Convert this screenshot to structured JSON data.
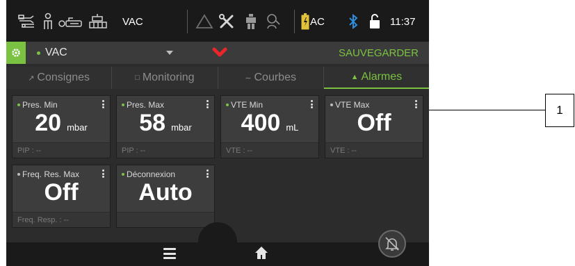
{
  "status_bar": {
    "mode_label": "VAC",
    "power_label": "AC",
    "time": "11:37",
    "icons": [
      "ventilation-circuit-icon",
      "patient-icon",
      "mask-icon",
      "hme-icon",
      "alarm-triangle-icon",
      "tools-icon",
      "pressure-source-icon",
      "profile-icon",
      "battery-icon",
      "bluetooth-icon",
      "lock-icon"
    ]
  },
  "header": {
    "mode_value": "VAC",
    "save_label": "SAUVEGARDER"
  },
  "tabs": [
    {
      "label": "Consignes",
      "icon": "wrench-icon",
      "active": false
    },
    {
      "label": "Monitoring",
      "icon": "monitor-icon",
      "active": false
    },
    {
      "label": "Courbes",
      "icon": "wave-icon",
      "active": false
    },
    {
      "label": "Alarmes",
      "icon": "bell-icon",
      "active": true
    }
  ],
  "alarms": [
    {
      "label": "Pres. Min",
      "value": "20",
      "unit": "mbar",
      "footer": "PIP : --",
      "active": true
    },
    {
      "label": "Pres. Max",
      "value": "58",
      "unit": "mbar",
      "footer": "PIP : --",
      "active": true
    },
    {
      "label": "VTE Min",
      "value": "400",
      "unit": "mL",
      "footer": "VTE : --",
      "active": true
    },
    {
      "label": "VTE Max",
      "value": "Off",
      "unit": "",
      "footer": "VTE : --",
      "active": false
    },
    {
      "label": "Freq. Res. Max",
      "value": "Off",
      "unit": "",
      "footer": "Freq. Resp. : --",
      "active": false
    },
    {
      "label": "Déconnexion",
      "value": "Auto",
      "unit": "",
      "footer": "",
      "active": true
    }
  ],
  "callout": {
    "number": "1"
  },
  "colors": {
    "accent": "#7cc242",
    "alarm_red": "#e8262b",
    "bluetooth": "#2f8fe0",
    "background": "#2c2c2c"
  }
}
